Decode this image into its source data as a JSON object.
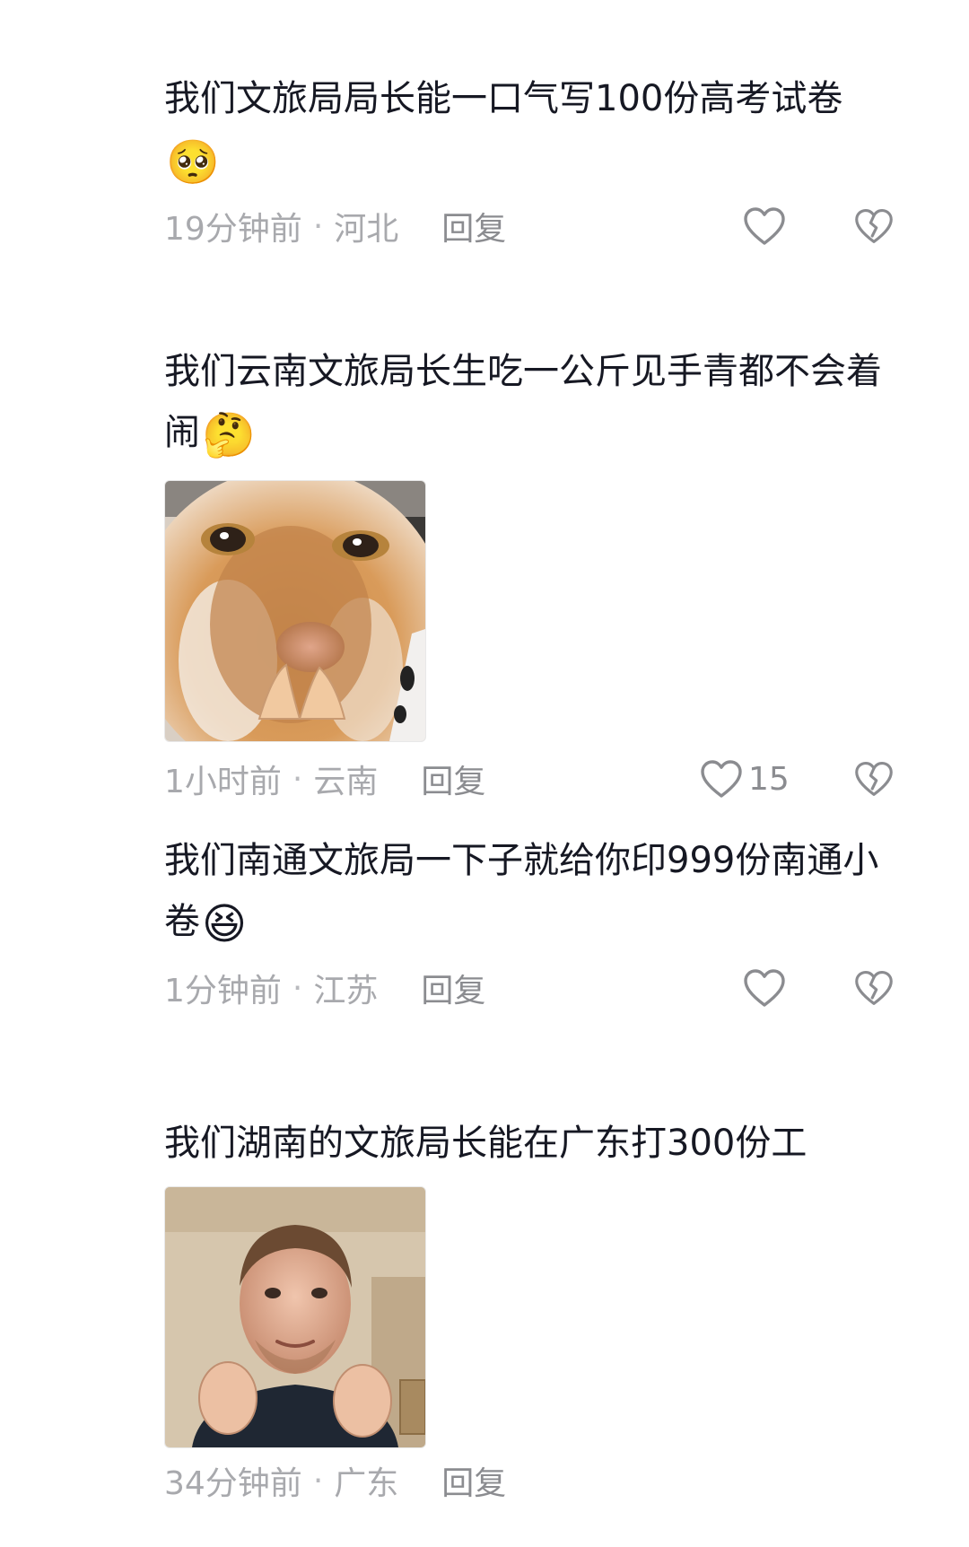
{
  "comments": [
    {
      "text": "我们文旅局局长能一口气写100份高考试卷",
      "emoji": "🥺",
      "time": "19分钟前",
      "location": "河北",
      "reply_label": "回复",
      "like_count": ""
    },
    {
      "text": "我们云南文旅局长生吃一公斤见手青都不会着闹",
      "emoji": "🤔",
      "time": "1小时前",
      "location": "云南",
      "reply_label": "回复",
      "like_count": "15",
      "image_description": "cat-meme"
    },
    {
      "text": "我们南通文旅局一下子就给你印999份南通小卷",
      "emoji": "😆",
      "time": "1分钟前",
      "location": "江苏",
      "reply_label": "回复",
      "like_count": ""
    },
    {
      "text": "我们湖南的文旅局长能在广东打300份工",
      "emoji": "",
      "time": "34分钟前",
      "location": "广东",
      "reply_label": "回复",
      "like_count": "",
      "image_description": "man-meme"
    }
  ],
  "separator": "·",
  "icons": {
    "like": "heart-outline-icon",
    "dislike": "broken-heart-icon"
  },
  "colors": {
    "text": "#161823",
    "meta": "#a8a9ad",
    "icon": "#8b8c90",
    "background": "#ffffff"
  }
}
